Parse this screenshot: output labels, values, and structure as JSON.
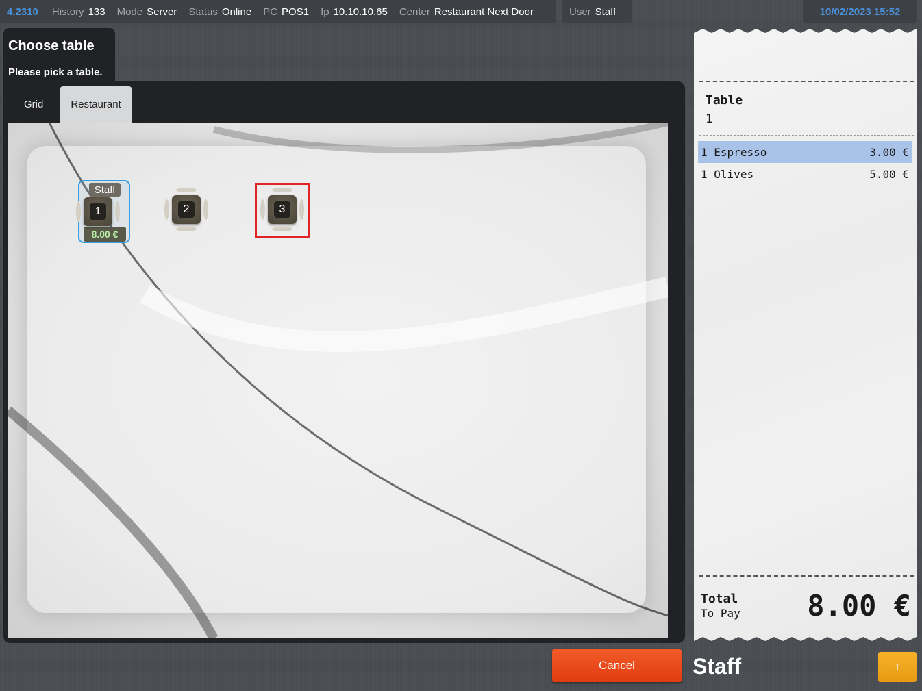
{
  "status_bar": {
    "version": "4.2310",
    "history_label": "History",
    "history_value": "133",
    "mode_label": "Mode",
    "mode_value": "Server",
    "status_label": "Status",
    "status_value": "Online",
    "pc_label": "PC",
    "pc_value": "POS1",
    "ip_label": "Ip",
    "ip_value": "10.10.10.65",
    "center_label": "Center",
    "center_value": "Restaurant Next Door",
    "user_label": "User",
    "user_value": "Staff",
    "datetime": "10/02/2023 15:52"
  },
  "header": {
    "title": "Choose table",
    "subtitle": "Please pick a table."
  },
  "tabs": [
    {
      "label": "Grid",
      "active": false
    },
    {
      "label": "Restaurant",
      "active": true
    }
  ],
  "tables": [
    {
      "number": "1",
      "occupied": true,
      "user": "Staff",
      "amount": "8.00 €"
    },
    {
      "number": "2",
      "occupied": false
    },
    {
      "number": "3",
      "occupied": false,
      "highlighted": true
    }
  ],
  "receipt": {
    "table_label": "Table",
    "table_number": "1",
    "lines": [
      {
        "qty": "1",
        "name": "Espresso",
        "price": "3.00 €",
        "selected": true
      },
      {
        "qty": "1",
        "name": "Olives",
        "price": "5.00 €",
        "selected": false
      }
    ],
    "total_label": "Total",
    "to_pay_label": "To Pay",
    "total_amount": "8.00 €"
  },
  "footer": {
    "cancel_label": "Cancel",
    "staff_name": "Staff",
    "user_button_label": "T"
  },
  "colors": {
    "accent_blue": "#4a90d9",
    "online_green": "#2c9a2c",
    "cancel_orange": "#f25a28",
    "user_button_yellow": "#f7b22a",
    "highlight_red": "#e02424",
    "selected_line": "#a9c3e8"
  }
}
